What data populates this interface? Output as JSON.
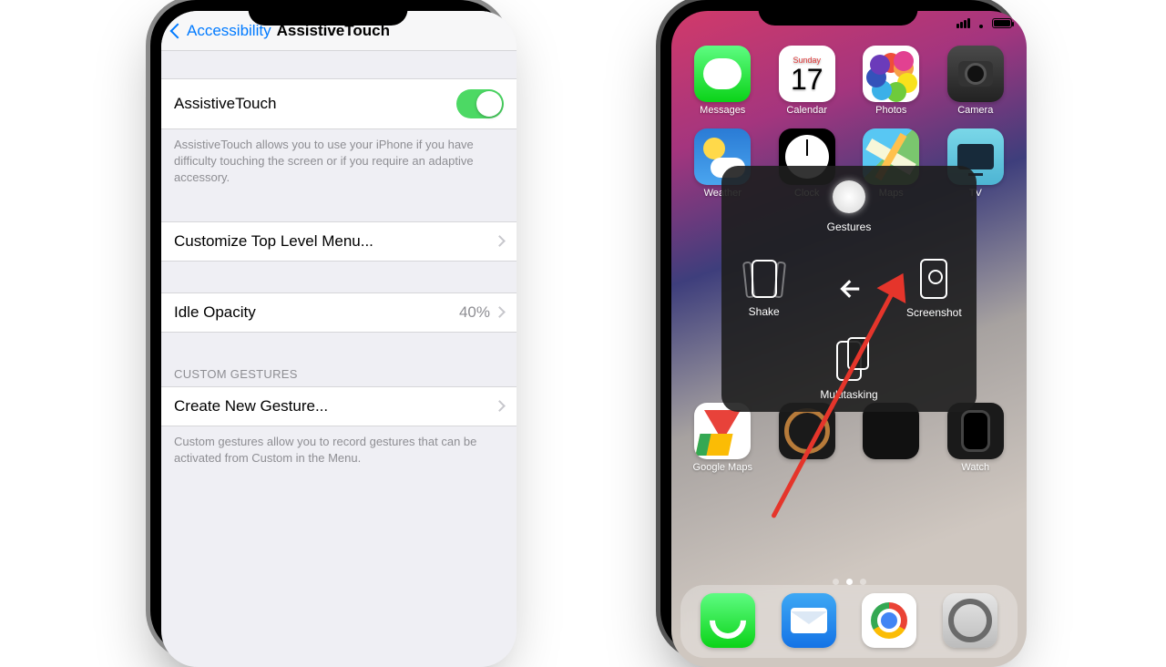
{
  "left_phone": {
    "back_label": "Accessibility",
    "title": "AssistiveTouch",
    "toggle_group": {
      "row_label": "AssistiveTouch",
      "footer": "AssistiveTouch allows you to use your iPhone if you have difficulty touching the screen or if you require an adaptive accessory."
    },
    "customize_group": {
      "menu_label": "Customize Top Level Menu...",
      "idle_label": "Idle Opacity",
      "idle_value": "40%"
    },
    "gestures_group": {
      "header": "Custom Gestures",
      "row_label": "Create New Gesture...",
      "footer": "Custom gestures allow you to record gestures that can be activated from Custom in the Menu."
    }
  },
  "right_phone": {
    "calendar": {
      "day": "Sunday",
      "date": "17"
    },
    "apps": {
      "messages": "Messages",
      "calendar": "Calendar",
      "photos": "Photos",
      "camera": "Camera",
      "weather": "Weather",
      "clock": "Clock",
      "maps": "Maps",
      "tv": "TV",
      "gmaps": "Google Maps",
      "watch": "Watch"
    },
    "at_menu": {
      "gestures": "Gestures",
      "shake": "Shake",
      "screenshot": "Screenshot",
      "multitask": "Multitasking"
    }
  }
}
